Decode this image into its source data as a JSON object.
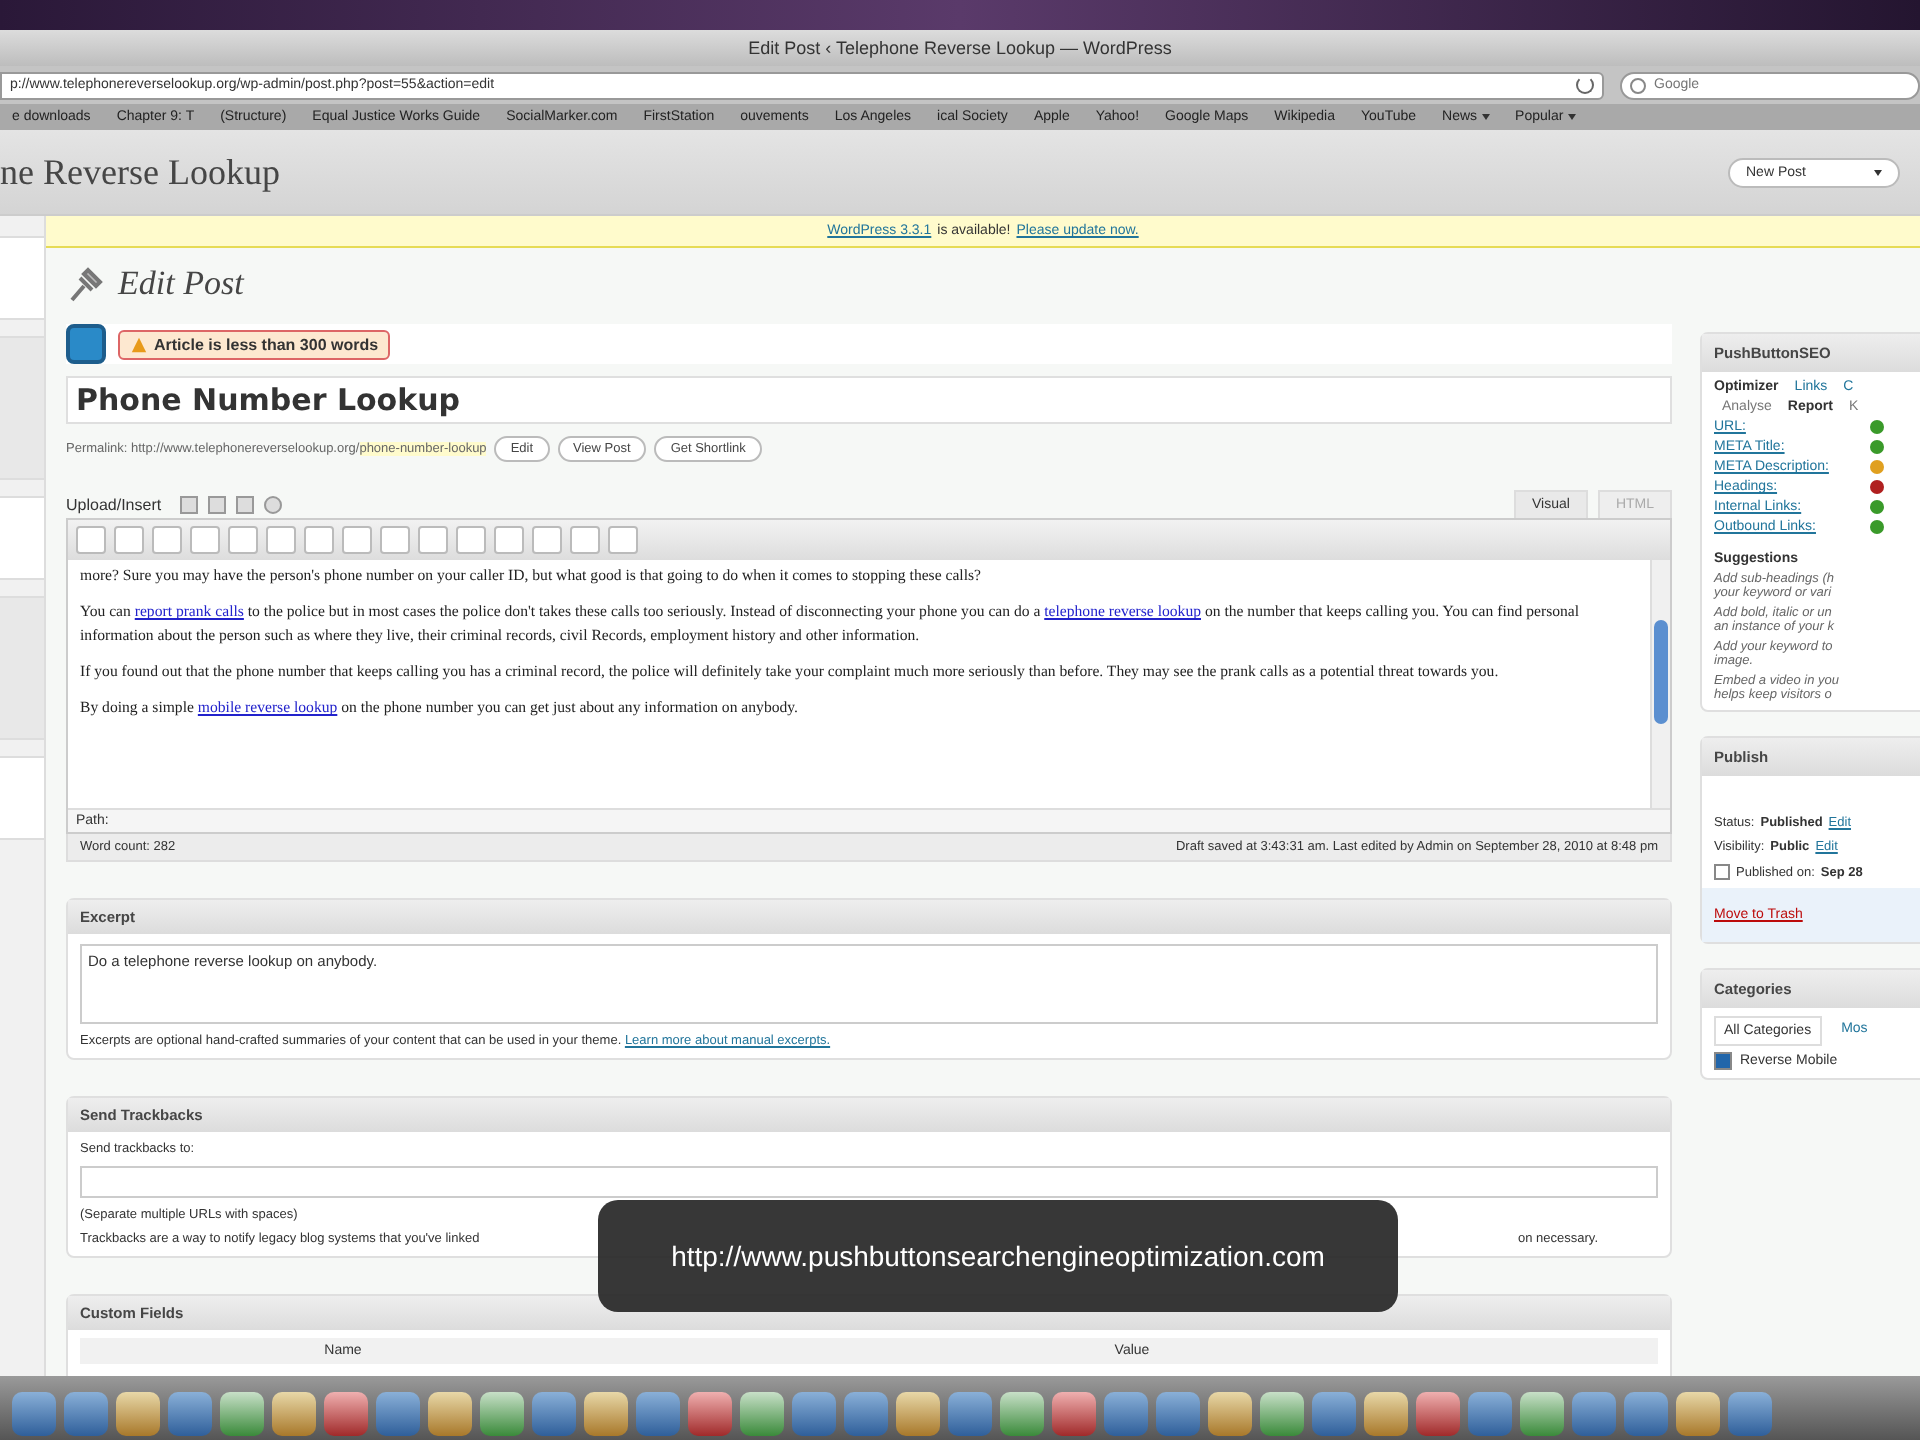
{
  "window": {
    "title": "Edit Post ‹ Telephone Reverse Lookup — WordPress"
  },
  "browser": {
    "url": "p://www.telephonereverselookup.org/wp-admin/post.php?post=55&action=edit",
    "search_placeholder": "Google",
    "bookmarks": [
      {
        "label": "e downloads",
        "menu": false
      },
      {
        "label": "Chapter 9: T",
        "menu": false
      },
      {
        "label": "(Structure)",
        "menu": false
      },
      {
        "label": "Equal Justice Works Guide",
        "menu": false
      },
      {
        "label": "SocialMarker.com",
        "menu": false
      },
      {
        "label": "FirstStation",
        "menu": false
      },
      {
        "label": "ouvements",
        "menu": false
      },
      {
        "label": "Los Angeles",
        "menu": false
      },
      {
        "label": "ical Society",
        "menu": false
      },
      {
        "label": "Apple",
        "menu": false
      },
      {
        "label": "Yahoo!",
        "menu": false
      },
      {
        "label": "Google Maps",
        "menu": false
      },
      {
        "label": "Wikipedia",
        "menu": false
      },
      {
        "label": "YouTube",
        "menu": false
      },
      {
        "label": "News",
        "menu": true
      },
      {
        "label": "Popular",
        "menu": true
      }
    ]
  },
  "header": {
    "site_title": "ne Reverse Lookup",
    "new_post": "New Post"
  },
  "notice": {
    "link1": "WordPress 3.3.1",
    "text": "is available!",
    "link2": "Please update now."
  },
  "page_title": "Edit Post",
  "warning": "Article is less than 300 words",
  "post_title": "Phone Number Lookup",
  "permalink": {
    "label": "Permalink: http://www.telephonereverselookup.org/",
    "slug": "phone-number-lookup",
    "buttons": [
      "Edit",
      "View Post",
      "Get Shortlink"
    ]
  },
  "upload_label": "Upload/Insert",
  "editor_tabs": [
    {
      "label": "Visual",
      "selected": true
    },
    {
      "label": "HTML",
      "selected": false
    }
  ],
  "content": [
    [
      {
        "text": "more? Sure you may have the person's phone number on your caller ID, but what good is that going to do when it comes to stopping these calls?",
        "link": false
      }
    ],
    [
      {
        "text": "You can ",
        "link": false
      },
      {
        "text": "report prank calls",
        "link": true
      },
      {
        "text": " to the police but in most cases the police don't takes these calls too seriously. Instead of disconnecting your phone you can do a ",
        "link": false
      },
      {
        "text": "telephone reverse lookup",
        "link": true
      },
      {
        "text": " on the number that keeps calling you. You can find personal information about the person such as where they live, their criminal records, civil Records, employment history and other information.",
        "link": false
      }
    ],
    [
      {
        "text": "If you found out that the phone number that keeps calling you has a criminal record, the police will definitely take your complaint much more seriously than before. They may see the prank calls as a potential threat towards you.",
        "link": false
      }
    ],
    [
      {
        "text": "By doing a simple ",
        "link": false
      },
      {
        "text": "mobile reverse lookup",
        "link": true
      },
      {
        "text": " on the phone number you can get just about any information on anybody.",
        "link": false
      }
    ]
  ],
  "path_label": "Path:",
  "word_count": "Word count: 282",
  "draft_status": "Draft saved at 3:43:31 am. Last edited by Admin on September 28, 2010 at 8:48 pm",
  "excerpt": {
    "title": "Excerpt",
    "value": "Do a telephone reverse lookup on anybody.",
    "help": "Excerpts are optional hand-crafted summaries of your content that can be used in your theme.",
    "link": "Learn more about manual excerpts."
  },
  "trackbacks": {
    "title": "Send Trackbacks",
    "label": "Send trackbacks to:",
    "hint": "(Separate multiple URLs with spaces)",
    "help_start": "Trackbacks are a way to notify legacy blog systems that you've linked",
    "help_end": "on necessary."
  },
  "custom_fields": {
    "title": "Custom Fields",
    "columns": [
      "Name",
      "Value"
    ]
  },
  "seo": {
    "title": "PushButtonSEO",
    "tabs": [
      {
        "label": "Optimizer",
        "selected": true
      },
      {
        "label": "Links",
        "selected": false
      },
      {
        "label": "C",
        "selected": false
      }
    ],
    "subtabs": [
      {
        "label": "Analyse",
        "selected": false
      },
      {
        "label": "Report",
        "selected": true
      },
      {
        "label": "K",
        "selected": false
      }
    ],
    "checks": [
      {
        "label": "URL:",
        "color": "#3a9a2a"
      },
      {
        "label": "META Title:",
        "color": "#3a9a2a"
      },
      {
        "label": "META Description:",
        "color": "#e0a020"
      },
      {
        "label": "Headings:",
        "color": "#b02020"
      },
      {
        "label": "Internal Links:",
        "color": "#3a9a2a"
      },
      {
        "label": "Outbound Links:",
        "color": "#3a9a2a"
      }
    ],
    "suggestions_title": "Suggestions",
    "suggestions": [
      [
        "Add sub-headings (h",
        "your keyword or vari"
      ],
      [
        "Add bold, italic or un",
        "an instance of your k"
      ],
      [
        "Add your keyword to",
        "image."
      ],
      [
        "Embed a video in you",
        "helps keep visitors o"
      ]
    ]
  },
  "publish": {
    "title": "Publish",
    "status_label": "Status:",
    "status": "Published",
    "visibility_label": "Visibility:",
    "visibility": "Public",
    "status_edit": "Edit",
    "visibility_edit": "Edit",
    "published_on": "Published on:",
    "date": "Sep 28",
    "trash": "Move to Trash"
  },
  "categories": {
    "title": "Categories",
    "tabs": [
      {
        "label": "All Categories",
        "selected": true
      },
      {
        "label": "Mos",
        "selected": false
      }
    ],
    "items": [
      {
        "label": "Reverse Mobile",
        "checked": true
      }
    ]
  },
  "caption": "http://www.pushbuttonsearchengineoptimization.com"
}
